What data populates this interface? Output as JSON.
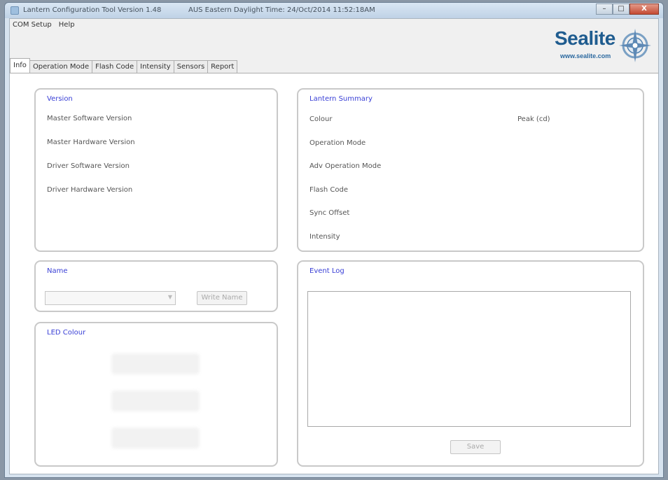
{
  "window": {
    "title": "Lantern Configuration Tool Version 1.48",
    "clock": "AUS Eastern Daylight Time: 24/Oct/2014 11:52:18AM",
    "buttons": {
      "minimize": "–",
      "maximize": "□",
      "close": "X"
    }
  },
  "menu": [
    "COM Setup",
    "Help"
  ],
  "logo": {
    "word": "Sealite",
    "url": "www.sealite.com"
  },
  "tabs": [
    "Info",
    "Operation Mode",
    "Flash Code",
    "Intensity",
    "Sensors",
    "Report"
  ],
  "version": {
    "title": "Version",
    "rows": [
      "Master Software Version",
      "Master Hardware Version",
      "Driver Software Version",
      "Driver Hardware Version"
    ]
  },
  "summary": {
    "title": "Lantern Summary",
    "rows": [
      "Colour",
      "Operation Mode",
      "Adv Operation Mode",
      "Flash Code",
      "Sync Offset",
      "Intensity"
    ],
    "peak": "Peak (cd)"
  },
  "name": {
    "title": "Name",
    "value": "",
    "write_button": "Write Name"
  },
  "led": {
    "title": "LED Colour"
  },
  "eventlog": {
    "title": "Event Log",
    "content": "",
    "save_button": "Save"
  },
  "colors": {
    "group_title": "#3a40d6",
    "brand": "#1f5c8f"
  },
  "icons": [
    "app-icon",
    "compass-rose-icon",
    "dropdown-arrow-icon"
  ]
}
